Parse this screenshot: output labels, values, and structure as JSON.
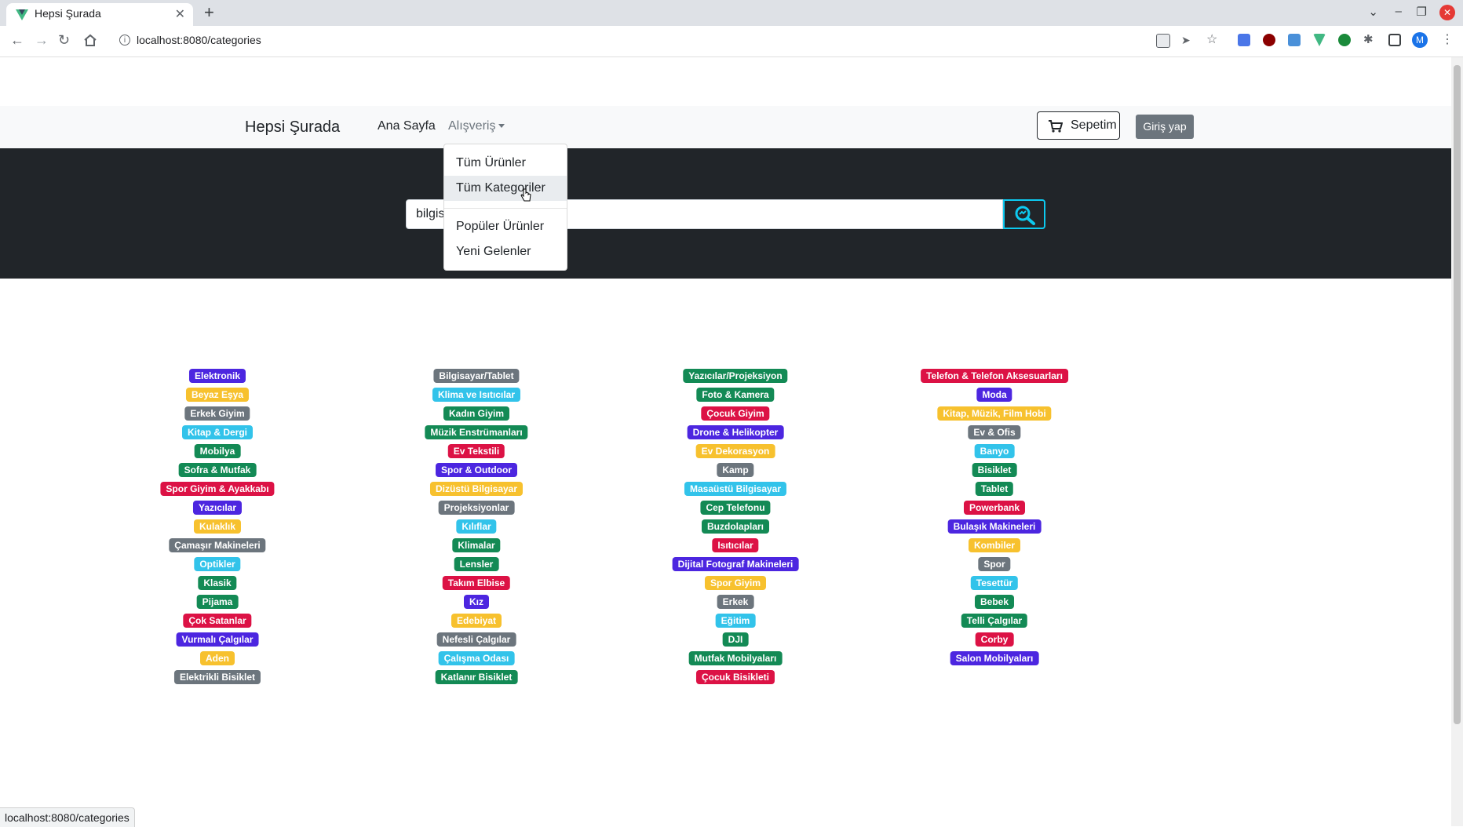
{
  "browser": {
    "tab_title": "Hepsi Şurada",
    "url": "localhost:8080/categories",
    "status_url": "localhost:8080/categories",
    "profile_initial": "M"
  },
  "navbar": {
    "brand": "Hepsi Şurada",
    "home": "Ana Sayfa",
    "shopping": "Alışveriş",
    "cart": "Sepetim",
    "login": "Giriş yap"
  },
  "dropdown": {
    "items": [
      "Tüm Ürünler",
      "Tüm Kategoriler",
      "Popüler Ürünler",
      "Yeni Gelenler"
    ]
  },
  "search": {
    "value": "bilgisayar"
  },
  "colors": {
    "primary": "#0d6efd",
    "indigo": "#4c26e0",
    "warning": "#f7c12e",
    "secondary": "#6c757d",
    "info": "#32c3ea",
    "success": "#138a55",
    "danger": "#dc1245"
  },
  "categories": [
    [
      {
        "label": "Elektronik",
        "color": "indigo"
      },
      {
        "label": "Beyaz Eşya",
        "color": "warning"
      },
      {
        "label": "Erkek Giyim",
        "color": "secondary"
      },
      {
        "label": "Kitap & Dergi",
        "color": "info"
      },
      {
        "label": "Mobilya",
        "color": "success"
      },
      {
        "label": "Sofra & Mutfak",
        "color": "success"
      },
      {
        "label": "Spor Giyim & Ayakkabı",
        "color": "danger"
      },
      {
        "label": "Yazıcılar",
        "color": "indigo"
      },
      {
        "label": "Kulaklık",
        "color": "warning"
      },
      {
        "label": "Çamaşır Makineleri",
        "color": "secondary"
      },
      {
        "label": "Optikler",
        "color": "info"
      },
      {
        "label": "Klasik",
        "color": "success"
      },
      {
        "label": "Pijama",
        "color": "success"
      },
      {
        "label": "Çok Satanlar",
        "color": "danger"
      },
      {
        "label": "Vurmalı Çalgılar",
        "color": "indigo"
      },
      {
        "label": "Aden",
        "color": "warning"
      },
      {
        "label": "Elektrikli Bisiklet",
        "color": "secondary"
      }
    ],
    [
      {
        "label": "Bilgisayar/Tablet",
        "color": "secondary"
      },
      {
        "label": "Klima ve Isıtıcılar",
        "color": "info"
      },
      {
        "label": "Kadın Giyim",
        "color": "success"
      },
      {
        "label": "Müzik Enstrümanları",
        "color": "success"
      },
      {
        "label": "Ev Tekstili",
        "color": "danger"
      },
      {
        "label": "Spor & Outdoor",
        "color": "indigo"
      },
      {
        "label": "Dizüstü Bilgisayar",
        "color": "warning"
      },
      {
        "label": "Projeksiyonlar",
        "color": "secondary"
      },
      {
        "label": "Kılıflar",
        "color": "info"
      },
      {
        "label": "Klimalar",
        "color": "success"
      },
      {
        "label": "Lensler",
        "color": "success"
      },
      {
        "label": "Takım Elbise",
        "color": "danger"
      },
      {
        "label": "Kız",
        "color": "indigo"
      },
      {
        "label": "Edebiyat",
        "color": "warning"
      },
      {
        "label": "Nefesli Çalgılar",
        "color": "secondary"
      },
      {
        "label": "Çalışma Odası",
        "color": "info"
      },
      {
        "label": "Katlanır Bisiklet",
        "color": "success"
      }
    ],
    [
      {
        "label": "Yazıcılar/Projeksiyon",
        "color": "success"
      },
      {
        "label": "Foto & Kamera",
        "color": "success"
      },
      {
        "label": "Çocuk Giyim",
        "color": "danger"
      },
      {
        "label": "Drone & Helikopter",
        "color": "indigo"
      },
      {
        "label": "Ev Dekorasyon",
        "color": "warning"
      },
      {
        "label": "Kamp",
        "color": "secondary"
      },
      {
        "label": "Masaüstü Bilgisayar",
        "color": "info"
      },
      {
        "label": "Cep Telefonu",
        "color": "success"
      },
      {
        "label": "Buzdolapları",
        "color": "success"
      },
      {
        "label": "Isıtıcılar",
        "color": "danger"
      },
      {
        "label": "Dijital Fotograf Makineleri",
        "color": "indigo"
      },
      {
        "label": "Spor Giyim",
        "color": "warning"
      },
      {
        "label": "Erkek",
        "color": "secondary"
      },
      {
        "label": "Eğitim",
        "color": "info"
      },
      {
        "label": "DJI",
        "color": "success"
      },
      {
        "label": "Mutfak Mobilyaları",
        "color": "success"
      },
      {
        "label": "Çocuk Bisikleti",
        "color": "danger"
      }
    ],
    [
      {
        "label": "Telefon & Telefon Aksesuarları",
        "color": "danger"
      },
      {
        "label": "Moda",
        "color": "indigo"
      },
      {
        "label": "Kitap, Müzik, Film Hobi",
        "color": "warning"
      },
      {
        "label": "Ev & Ofis",
        "color": "secondary"
      },
      {
        "label": "Banyo",
        "color": "info"
      },
      {
        "label": "Bisiklet",
        "color": "success"
      },
      {
        "label": "Tablet",
        "color": "success"
      },
      {
        "label": "Powerbank",
        "color": "danger"
      },
      {
        "label": "Bulaşık Makineleri",
        "color": "indigo"
      },
      {
        "label": "Kombiler",
        "color": "warning"
      },
      {
        "label": "Spor",
        "color": "secondary"
      },
      {
        "label": "Tesettür",
        "color": "info"
      },
      {
        "label": "Bebek",
        "color": "success"
      },
      {
        "label": "Telli Çalgılar",
        "color": "success"
      },
      {
        "label": "Corby",
        "color": "danger"
      },
      {
        "label": "Salon Mobilyaları",
        "color": "indigo"
      }
    ]
  ]
}
